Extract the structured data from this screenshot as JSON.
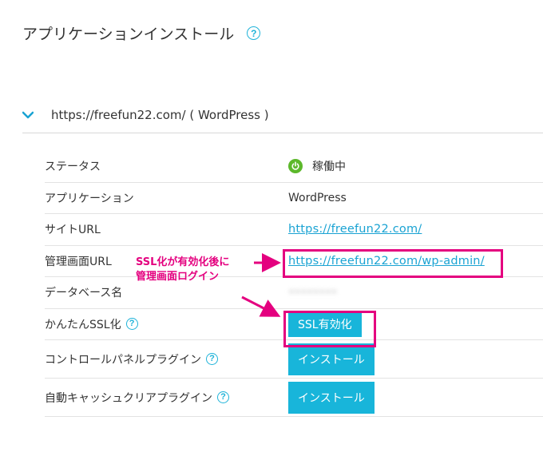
{
  "page": {
    "title": "アプリケーションインストール",
    "help": "?"
  },
  "section": {
    "title": "https://freefun22.com/ ( WordPress )"
  },
  "rows": [
    {
      "label": "ステータス",
      "value": "稼働中"
    },
    {
      "label": "アプリケーション",
      "value": "WordPress"
    },
    {
      "label": "サイトURL",
      "value": "https://freefun22.com/"
    },
    {
      "label": "管理画面URL",
      "value": "https://freefun22.com/wp-admin/"
    },
    {
      "label": "データベース名",
      "value": "••••••••"
    },
    {
      "label": "かんたんSSL化",
      "button": "SSL有効化"
    },
    {
      "label": "コントロールパネルプラグイン",
      "button": "インストール"
    },
    {
      "label": "自動キャッシュクリアプラグイン",
      "button": "インストール"
    }
  ],
  "annotation": {
    "line1": "SSL化が有効化後に",
    "line2": "管理画面ログイン"
  },
  "colors": {
    "accent": "#18b5da",
    "status_green": "#5cb82b",
    "annotation_pink": "#e4007f",
    "link": "#1aa3d3"
  }
}
